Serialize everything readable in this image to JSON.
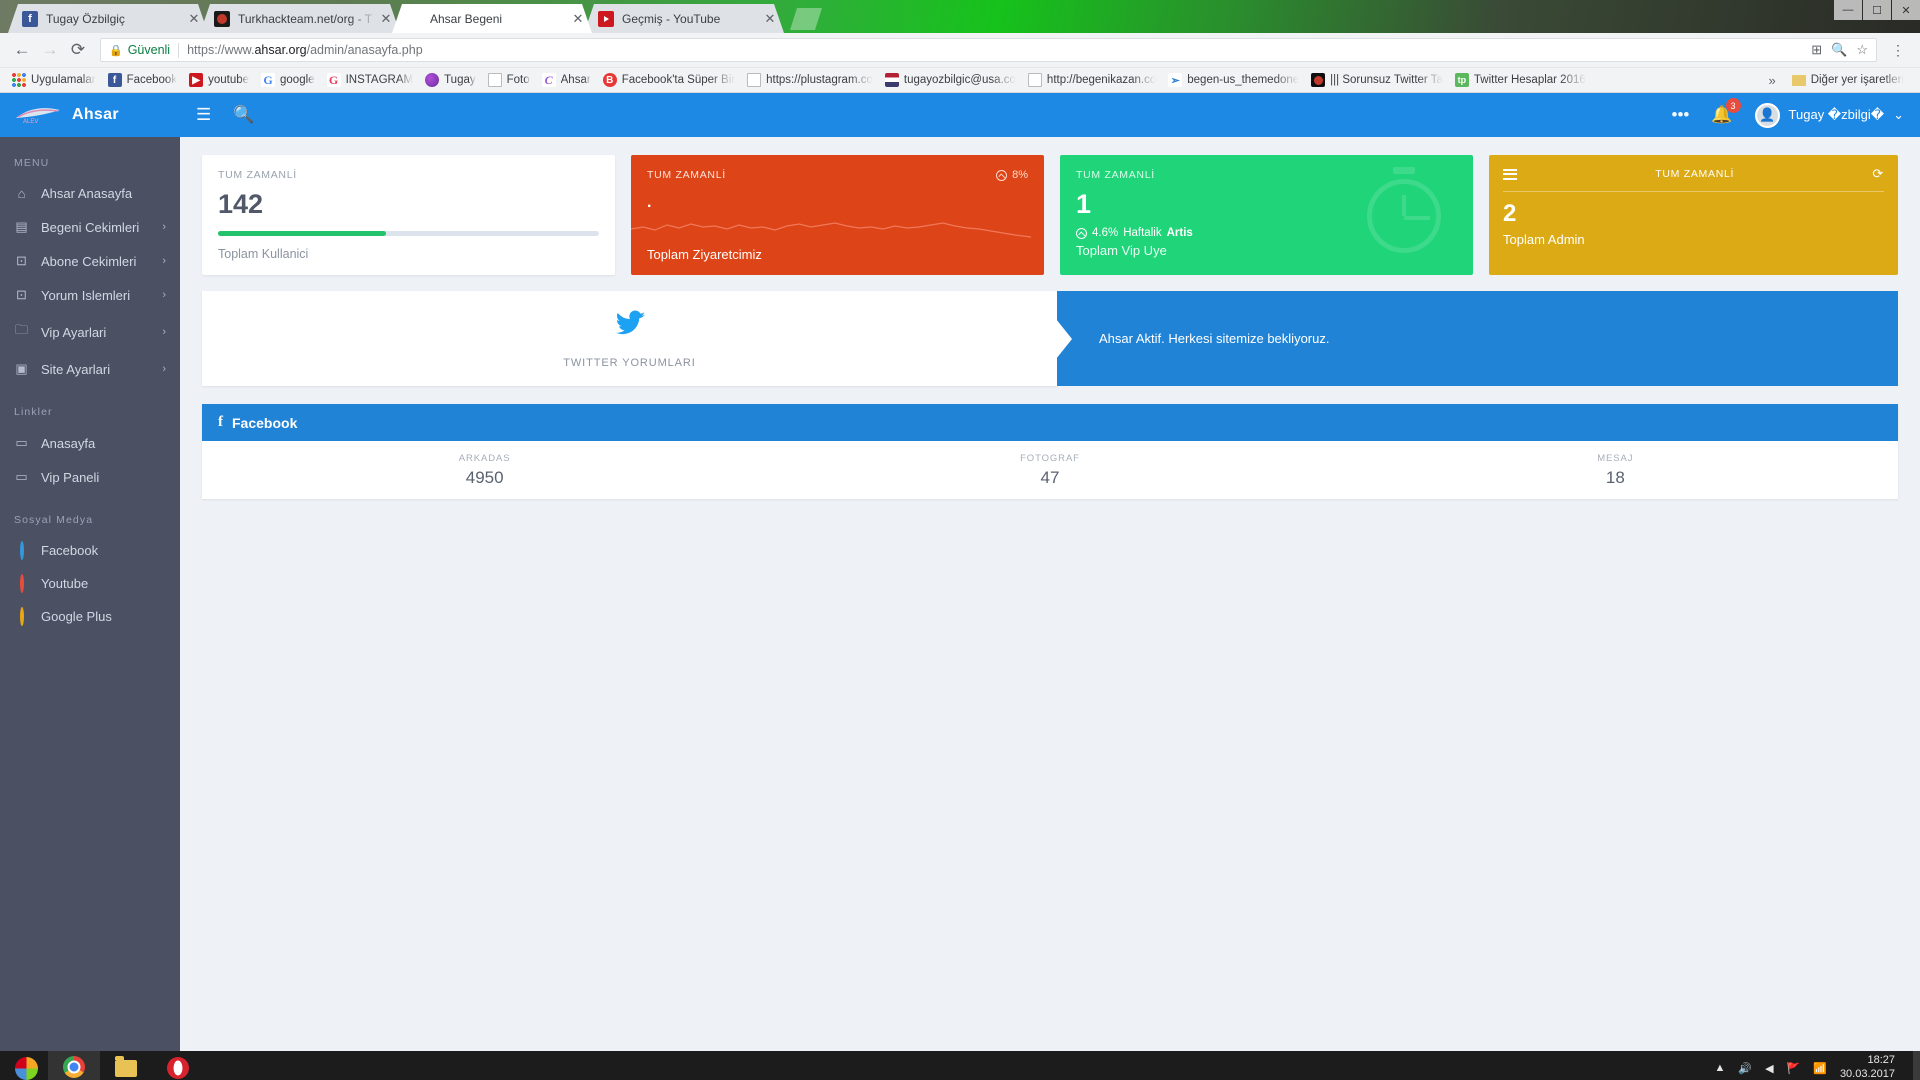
{
  "browser": {
    "tabs": [
      {
        "title": "Tugay Özbilgiç",
        "favicon": "facebook-icon",
        "favclass": "fav-fb",
        "favtext": "f",
        "active": false
      },
      {
        "title": "Turkhackteam.net/org - T",
        "favicon": "turkhackteam-icon",
        "favclass": "fav-tht",
        "favtext": "",
        "active": false
      },
      {
        "title": "Ahsar Begeni",
        "favicon": "ahsar-icon",
        "favclass": "fav-chr",
        "favtext": "C",
        "active": true
      },
      {
        "title": "Geçmiş - YouTube",
        "favicon": "youtube-icon",
        "favclass": "fav-yt",
        "favtext": "",
        "active": false
      }
    ],
    "close_label": "✕",
    "nav": {
      "back": "←",
      "forward": "→",
      "reload": "⟳"
    },
    "omnibox": {
      "secure_label": "Güvenli",
      "lock_icon": "lock-icon",
      "url_scheme": "https://www.",
      "url_domain": "ahsar.org",
      "url_path": "/admin/anasayfa.php",
      "full_url": "https://www.ahsar.org/admin/anasayfa.php"
    },
    "toolbar_icons": {
      "extension": "⊞",
      "search": "🔍",
      "star": "☆",
      "menu": "⋮"
    },
    "window_controls": [
      "—",
      "☐",
      "✕"
    ],
    "bookmarks": [
      {
        "label": "Uygulamalar",
        "icon": "apps-grid-icon",
        "iconclass": "ico-apps",
        "glyph": ""
      },
      {
        "label": "Facebook",
        "icon": "facebook-icon",
        "iconclass": "ico-fb",
        "glyph": "f"
      },
      {
        "label": "youtube",
        "icon": "youtube-icon",
        "iconclass": "ico-yt",
        "glyph": "▶"
      },
      {
        "label": "google",
        "icon": "google-icon",
        "iconclass": "ico-g",
        "glyph": "G"
      },
      {
        "label": "İNSTAGRAM",
        "icon": "instagram-icon",
        "iconclass": "ico-ig",
        "glyph": "G"
      },
      {
        "label": "Tugay",
        "icon": "tugay-icon",
        "iconclass": "ico-tugay",
        "glyph": ""
      },
      {
        "label": "Foto",
        "icon": "document-icon",
        "iconclass": "ico-doc",
        "glyph": ""
      },
      {
        "label": "Ahsar",
        "icon": "ahsar-icon",
        "iconclass": "ico-ahsar",
        "glyph": "C"
      },
      {
        "label": "Facebook'ta Süper Bir",
        "icon": "bing-icon",
        "iconclass": "ico-b",
        "glyph": "B"
      },
      {
        "label": "https://plustagram.co",
        "icon": "document-icon",
        "iconclass": "ico-doc",
        "glyph": ""
      },
      {
        "label": "tugayozbilgic@usa.co",
        "icon": "usa-flag-icon",
        "iconclass": "ico-usa",
        "glyph": ""
      },
      {
        "label": "http://begenikazan.co",
        "icon": "document-icon",
        "iconclass": "ico-doc",
        "glyph": ""
      },
      {
        "label": "begen-us_themedone",
        "icon": "begen-icon",
        "iconclass": "ico-begen",
        "glyph": "➢"
      },
      {
        "label": "||| Sorunsuz Twitter Ta",
        "icon": "turkhackteam-icon",
        "iconclass": "ico-thtred",
        "glyph": ""
      },
      {
        "label": "Twitter Hesaplar 2016",
        "icon": "tp-icon",
        "iconclass": "ico-tp",
        "glyph": "tp"
      }
    ],
    "bookmarks_overflow": "»",
    "other_bookmarks": "Diğer yer işaretleri"
  },
  "app": {
    "brand": {
      "logo_text": "ALEV",
      "name": "Ahsar"
    },
    "topbar": {
      "menu_icon": "hamburger-icon",
      "search_icon": "search-icon",
      "more_icon": "more-horizontal-icon",
      "bell_icon": "bell-icon",
      "notification_count": "3",
      "avatar_icon": "user-avatar",
      "username": "Tugay �zbilgi�",
      "caret": "⌄"
    },
    "sidebar": {
      "menu_heading": "MENU",
      "menu_items": [
        {
          "label": "Ahsar Anasayfa",
          "icon": "home-icon",
          "glyph": "⌂",
          "arrow": ""
        },
        {
          "label": "Begeni Cekimleri",
          "icon": "window-icon",
          "glyph": "▤",
          "arrow": "›"
        },
        {
          "label": "Abone Cekimleri",
          "icon": "box-icon",
          "glyph": "⊡",
          "arrow": "›"
        },
        {
          "label": "Yorum Islemleri",
          "icon": "box-icon",
          "glyph": "⊡",
          "arrow": "›"
        },
        {
          "label": "Vip Ayarlari",
          "icon": "folder-icon",
          "glyph": "🗀",
          "arrow": "›"
        },
        {
          "label": "Site Ayarlari",
          "icon": "window-icon",
          "glyph": "▣",
          "arrow": "›"
        }
      ],
      "links_heading": "Linkler",
      "link_items": [
        {
          "label": "Anasayfa",
          "icon": "screen-icon",
          "glyph": "▭"
        },
        {
          "label": "Vip Paneli",
          "icon": "screen-icon",
          "glyph": "▭"
        }
      ],
      "social_heading": "Sosyal Medya",
      "social_items": [
        {
          "label": "Facebook",
          "icon": "circle-icon",
          "dotclass": "fb"
        },
        {
          "label": "Youtube",
          "icon": "circle-icon",
          "dotclass": "yt"
        },
        {
          "label": "Google Plus",
          "icon": "circle-icon",
          "dotclass": "gp"
        }
      ]
    },
    "cards": [
      {
        "type": "white",
        "title": "TUM ZAMANLİ",
        "value": "142",
        "footer": "Toplam Kullanici",
        "progress_percent": 44,
        "progress_color": "#22c36b"
      },
      {
        "type": "red",
        "title": "TUM ZAMANLİ",
        "value": ".",
        "footer": "Toplam Ziyaretcimiz",
        "percent_label": "8%",
        "percent_icon": "trend-circle-icon",
        "bg_color": "#dd4417"
      },
      {
        "type": "green",
        "title": "TUM ZAMANLİ",
        "value": "1",
        "sub_percent": "4.6%",
        "sub_text": "Haftalik",
        "sub_bold": "Artis",
        "footer": "Toplam Vip Uye",
        "icon": "stopwatch-icon",
        "bg_color": "#1fd479"
      },
      {
        "type": "yellow",
        "title": "TUM ZAMANLİ",
        "value": "2",
        "footer": "Toplam Admin",
        "menu_icon": "hamburger-icon",
        "refresh_icon": "refresh-icon",
        "refresh_glyph": "⟳",
        "bg_color": "#dbaa15"
      }
    ],
    "twitter_card": {
      "icon": "twitter-bird-icon",
      "glyph": "🐦",
      "label": "TWITTER YORUMLARI"
    },
    "notice": {
      "text": "Ahsar Aktif. Herkesi sitemize bekliyoruz."
    },
    "facebook_panel": {
      "title": "Facebook",
      "icon": "facebook-icon",
      "glyph": "f",
      "stats": [
        {
          "label": "ARKADAS",
          "value": "4950"
        },
        {
          "label": "FOTOGRAF",
          "value": "47"
        },
        {
          "label": "MESAJ",
          "value": "18"
        }
      ]
    }
  },
  "taskbar": {
    "start_icon": "windows-start-icon",
    "items": [
      {
        "icon": "chrome-icon",
        "name": "chrome-taskbar-item",
        "selected": true
      },
      {
        "icon": "folder-icon",
        "name": "explorer-taskbar-item",
        "selected": false
      },
      {
        "icon": "opera-icon",
        "name": "opera-taskbar-item",
        "selected": false
      }
    ],
    "tray_icons": [
      "▲",
      "🔊",
      "◀",
      "🚩",
      "📶"
    ],
    "time": "18:27",
    "date": "30.03.2017"
  }
}
